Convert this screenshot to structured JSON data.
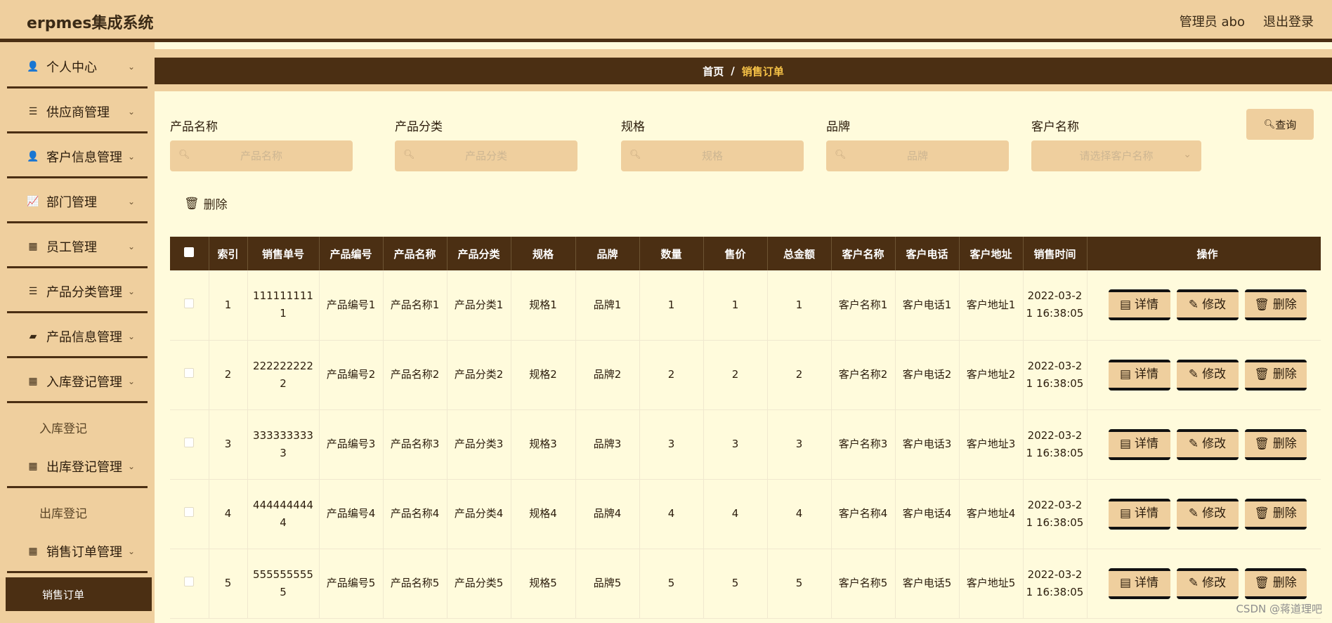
{
  "header": {
    "title": "erpmes集成系统",
    "user_label": "管理员 abo",
    "logout_label": "退出登录"
  },
  "sidebar": {
    "items": [
      {
        "label": "个人中心",
        "icon": "user-icon"
      },
      {
        "label": "供应商管理",
        "icon": "list-icon"
      },
      {
        "label": "客户信息管理",
        "icon": "user-icon"
      },
      {
        "label": "部门管理",
        "icon": "chart-icon"
      },
      {
        "label": "员工管理",
        "icon": "grid-icon"
      },
      {
        "label": "产品分类管理",
        "icon": "list-icon"
      },
      {
        "label": "产品信息管理",
        "icon": "wallet-icon"
      },
      {
        "label": "入库登记管理",
        "icon": "grid-icon"
      },
      {
        "label": "出库登记管理",
        "icon": "grid-icon"
      },
      {
        "label": "销售订单管理",
        "icon": "grid-icon"
      }
    ],
    "sub_inbound": "入库登记",
    "sub_outbound": "出库登记",
    "sub_sales": "销售订单"
  },
  "breadcrumb": {
    "home": "首页",
    "separator": "/",
    "current": "销售订单"
  },
  "filters": {
    "product_name": {
      "label": "产品名称",
      "placeholder": "产品名称"
    },
    "product_category": {
      "label": "产品分类",
      "placeholder": "产品分类"
    },
    "spec": {
      "label": "规格",
      "placeholder": "规格"
    },
    "brand": {
      "label": "品牌",
      "placeholder": "品牌"
    },
    "customer": {
      "label": "客户名称",
      "placeholder": "请选择客户名称"
    },
    "query_label": "查询",
    "delete_label": "删除"
  },
  "table": {
    "columns": [
      "索引",
      "销售单号",
      "产品编号",
      "产品名称",
      "产品分类",
      "规格",
      "品牌",
      "数量",
      "售价",
      "总金额",
      "客户名称",
      "客户电话",
      "客户地址",
      "销售时间",
      "操作"
    ],
    "rows": [
      [
        "1",
        "1111111111",
        "产品编号1",
        "产品名称1",
        "产品分类1",
        "规格1",
        "品牌1",
        "1",
        "1",
        "1",
        "客户名称1",
        "客户电话1",
        "客户地址1",
        "2022-03-21 16:38:05"
      ],
      [
        "2",
        "2222222222",
        "产品编号2",
        "产品名称2",
        "产品分类2",
        "规格2",
        "品牌2",
        "2",
        "2",
        "2",
        "客户名称2",
        "客户电话2",
        "客户地址2",
        "2022-03-21 16:38:05"
      ],
      [
        "3",
        "3333333333",
        "产品编号3",
        "产品名称3",
        "产品分类3",
        "规格3",
        "品牌3",
        "3",
        "3",
        "3",
        "客户名称3",
        "客户电话3",
        "客户地址3",
        "2022-03-21 16:38:05"
      ],
      [
        "4",
        "4444444444",
        "产品编号4",
        "产品名称4",
        "产品分类4",
        "规格4",
        "品牌4",
        "4",
        "4",
        "4",
        "客户名称4",
        "客户电话4",
        "客户地址4",
        "2022-03-21 16:38:05"
      ],
      [
        "5",
        "5555555555",
        "产品编号5",
        "产品名称5",
        "产品分类5",
        "规格5",
        "品牌5",
        "5",
        "5",
        "5",
        "客户名称5",
        "客户电话5",
        "客户地址5",
        "2022-03-21 16:38:05"
      ]
    ],
    "actions": {
      "detail": "详情",
      "edit": "修改",
      "delete": "删除"
    }
  },
  "watermark": "CSDN @蒋道理吧",
  "colors": {
    "brown": "#4b2f13",
    "tan": "#efcf9e",
    "cream": "#fffbdc",
    "accent": "#f6c247"
  }
}
